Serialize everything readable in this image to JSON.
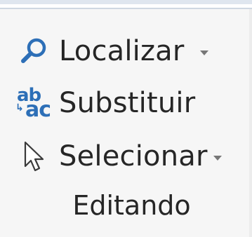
{
  "ribbon_group": {
    "commands": {
      "find": {
        "label": "Localizar",
        "icon": "magnifier-icon",
        "has_dropdown": true
      },
      "replace": {
        "label": "Substituir",
        "icon": "replace-ab-ac-icon",
        "has_dropdown": false
      },
      "select": {
        "label": "Selecionar",
        "icon": "cursor-arrow-icon",
        "has_dropdown": true
      }
    },
    "group_label": "Editando"
  },
  "colors": {
    "icon_blue": "#2d6fb7",
    "text": "#262626",
    "background": "#f6f6f6"
  },
  "replace_icon_text": {
    "top": "ab",
    "bottom": "ac"
  }
}
